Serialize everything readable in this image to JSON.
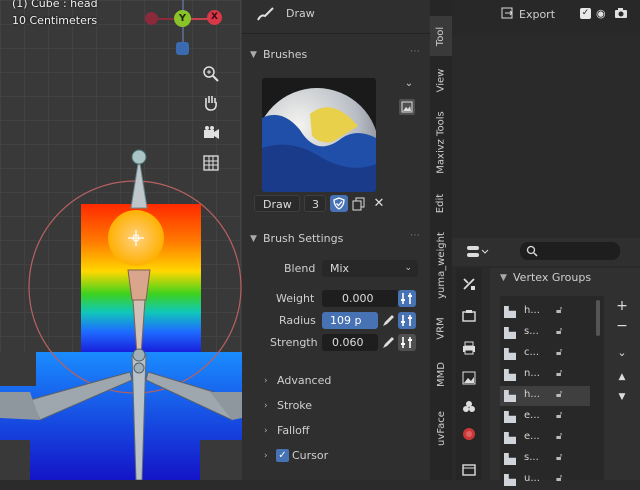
{
  "viewport": {
    "object_info": "(1) Cube : head",
    "scale_info": "10 Centimeters",
    "gizmo_labels": {
      "y": "Y",
      "x": "X"
    },
    "tool_icons": [
      "zoom-icon",
      "hand-icon",
      "camera-icon",
      "grid-icon"
    ]
  },
  "header": {
    "tool_name": "Draw"
  },
  "brushes": {
    "section_title": "Brushes",
    "brush_name": "Draw",
    "users": "3"
  },
  "brush_settings": {
    "section_title": "Brush Settings",
    "blend_label": "Blend",
    "blend_value": "Mix",
    "weight_label": "Weight",
    "weight_value": "0.000",
    "radius_label": "Radius",
    "radius_value": "109 p",
    "strength_label": "Strength",
    "strength_value": "0.060"
  },
  "subpanels": {
    "advanced": "Advanced",
    "stroke": "Stroke",
    "falloff": "Falloff",
    "cursor": "Cursor"
  },
  "tabs": {
    "tool": "Tool",
    "view": "View",
    "maxivz": "Maxivz Tools",
    "edit": "Edit",
    "yuma": "yuma_weight",
    "vrm": "VRM",
    "mmd": "MMD",
    "uvface": "uvFace"
  },
  "outliner": {
    "export_label": "Export"
  },
  "vertex_groups": {
    "title": "Vertex Groups",
    "items": [
      "h...",
      "s...",
      "c...",
      "n...",
      "h...",
      "e...",
      "e...",
      "s...",
      "u..."
    ]
  },
  "colors": {
    "accent_blue": "#4772b3",
    "panel_bg": "#2f2f2f",
    "field_bg": "#1e1e1e"
  }
}
